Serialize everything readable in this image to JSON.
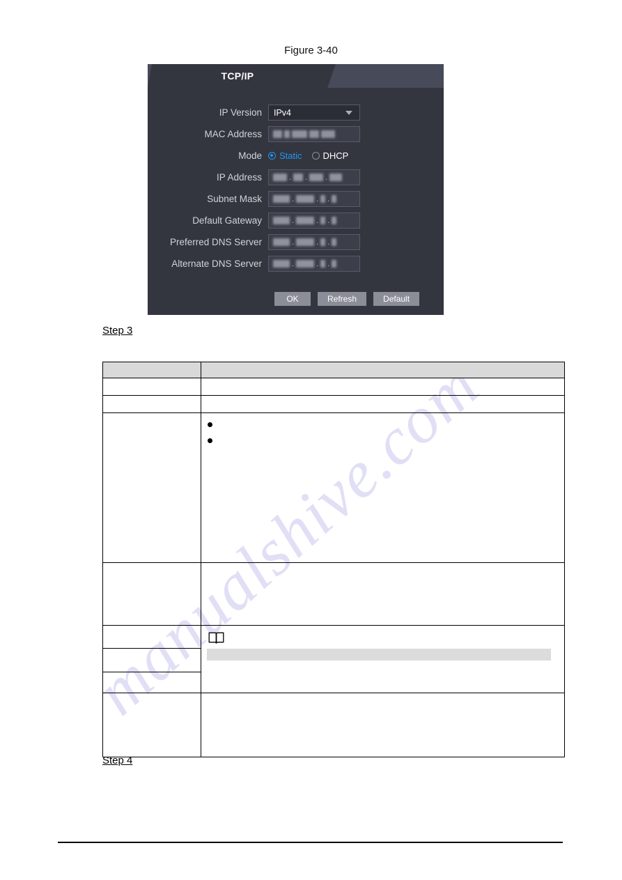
{
  "figure": {
    "caption": "Figure 3-40"
  },
  "dialog": {
    "title": "TCP/IP",
    "fields": {
      "ip_version": {
        "label": "IP Version",
        "value": "IPv4",
        "chevron_icon": "chevron-down-icon"
      },
      "mac_address": {
        "label": "MAC Address",
        "value": ""
      },
      "mode": {
        "label": "Mode",
        "options": [
          {
            "label": "Static",
            "selected": true
          },
          {
            "label": "DHCP",
            "selected": false
          }
        ]
      },
      "ip_address": {
        "label": "IP Address",
        "value": ""
      },
      "subnet_mask": {
        "label": "Subnet Mask",
        "value": ""
      },
      "default_gateway": {
        "label": "Default Gateway",
        "value": ""
      },
      "preferred_dns": {
        "label": "Preferred DNS Server",
        "value": ""
      },
      "alternate_dns": {
        "label": "Alternate DNS Server",
        "value": ""
      }
    },
    "buttons": {
      "ok": "OK",
      "refresh": "Refresh",
      "default": "Default"
    },
    "colors": {
      "panel_bg": "#33353f",
      "tabbar_bg": "#474a58",
      "input_bg": "#3c3f4a",
      "select_bg": "#2b2d36",
      "accent": "#2196f3",
      "button_bg": "#8b8d98",
      "label_text": "#d2d4da"
    }
  },
  "steps": {
    "step3": "Step 3",
    "step4": "Step 4"
  },
  "table": {
    "header": {
      "col1": "",
      "col2": ""
    },
    "rows": [
      {
        "col1": "",
        "col2": "",
        "type": "plain"
      },
      {
        "col1": "",
        "col2": "",
        "type": "plain"
      },
      {
        "col1": "",
        "col2": "",
        "type": "bullets",
        "bullets": [
          "",
          ""
        ]
      },
      {
        "col1": "",
        "col2": "",
        "type": "plain"
      },
      {
        "col1": "",
        "col2": "",
        "type": "plain"
      },
      {
        "col1": "",
        "col2": "",
        "type": "note",
        "note_icon": "book-note-icon",
        "note_text": ""
      },
      {
        "col1": "",
        "col2": "",
        "type": "plain"
      },
      {
        "col1": "",
        "col2": "",
        "type": "plain"
      }
    ]
  },
  "watermark": {
    "text": "manualshive.com",
    "color": "#c9c6ee"
  }
}
